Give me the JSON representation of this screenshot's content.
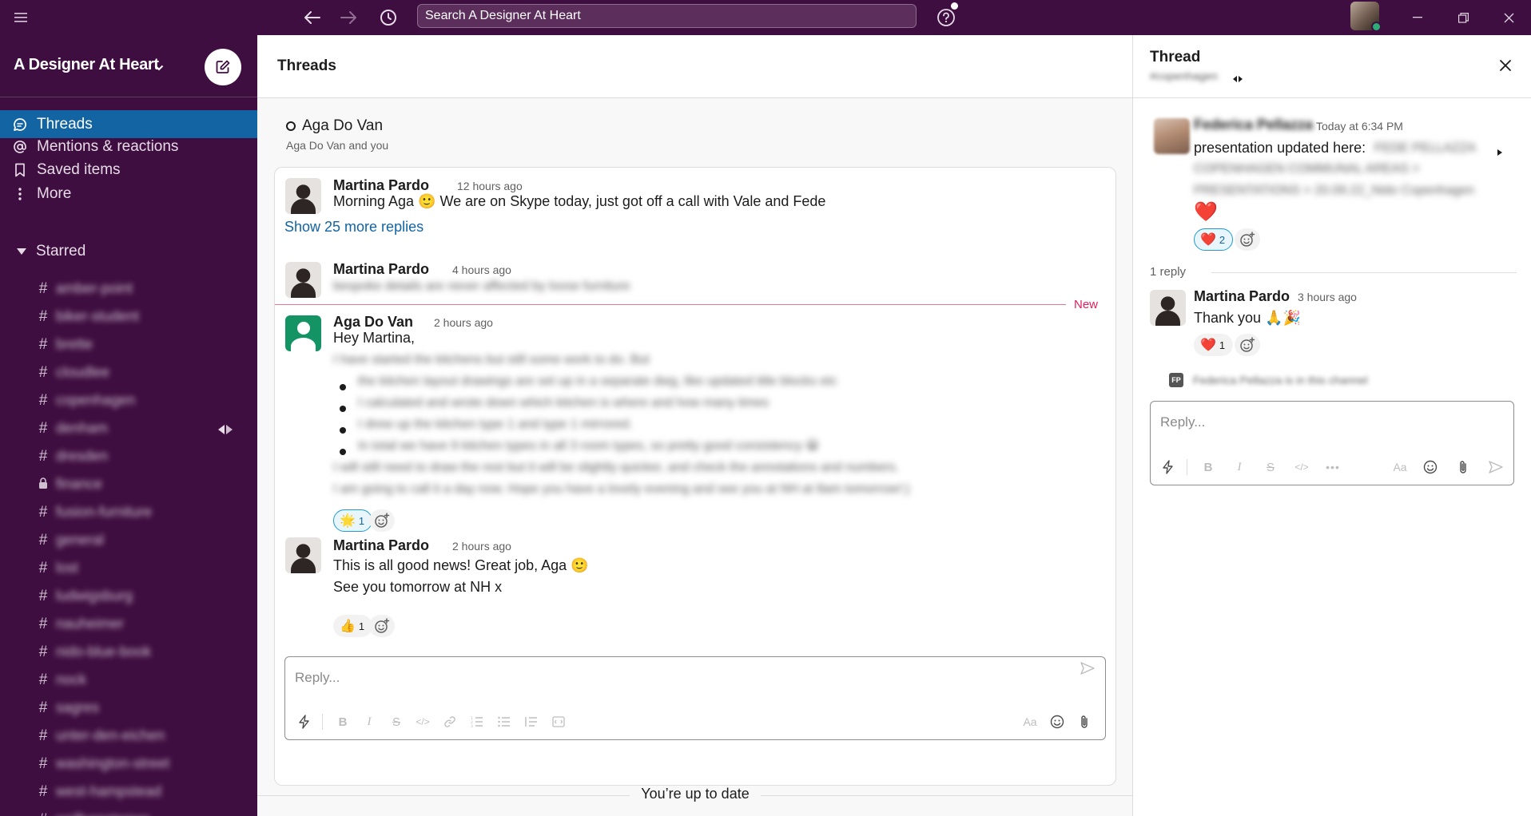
{
  "topbar": {
    "search_text": "Search A Designer At Heart"
  },
  "sidebar": {
    "workspace_name": "A Designer At Heart",
    "nav": [
      {
        "label": "Threads",
        "icon": "threads-icon",
        "active": true
      },
      {
        "label": "Mentions & reactions",
        "icon": "at-sign-icon",
        "active": false
      },
      {
        "label": "Saved items",
        "icon": "bookmark-icon",
        "active": false
      },
      {
        "label": "More",
        "icon": "more-vertical-icon",
        "active": false
      }
    ],
    "starred_label": "Starred",
    "channels": [
      {
        "name": "amber-point",
        "type": "public"
      },
      {
        "name": "biker-student",
        "type": "public"
      },
      {
        "name": "brette",
        "type": "public"
      },
      {
        "name": "cloudlee",
        "type": "public"
      },
      {
        "name": "copenhagen",
        "type": "shared"
      },
      {
        "name": "denham",
        "type": "public"
      },
      {
        "name": "dresden",
        "type": "public"
      },
      {
        "name": "finance",
        "type": "private"
      },
      {
        "name": "fusion-furniture",
        "type": "public"
      },
      {
        "name": "general",
        "type": "public"
      },
      {
        "name": "lost",
        "type": "public"
      },
      {
        "name": "ludwigsburg",
        "type": "public"
      },
      {
        "name": "nauheimer",
        "type": "public"
      },
      {
        "name": "nido-blue-book",
        "type": "public"
      },
      {
        "name": "nock",
        "type": "public"
      },
      {
        "name": "sagres",
        "type": "public"
      },
      {
        "name": "unter-den-eichen",
        "type": "public"
      },
      {
        "name": "washington-street",
        "type": "public"
      },
      {
        "name": "west-hampstead",
        "type": "public"
      },
      {
        "name": "wolfsensterner",
        "type": "public"
      }
    ]
  },
  "main": {
    "title": "Threads",
    "conversation": {
      "title": "Aga Do Van",
      "subtitle": "Aga Do Van and you"
    },
    "messages": [
      {
        "author": "Martina Pardo",
        "time": "12 hours ago",
        "text": "Morning Aga 🙂 We are on Skype today, just got off a call with Vale and Fede"
      },
      {
        "author": "Martina Pardo",
        "time": "4 hours ago",
        "text": "bespoke details are never affected by loose furniture"
      },
      {
        "author": "Aga Do Van",
        "time": "2 hours ago",
        "greeting": "Hey Martina,",
        "lines": [
          "I have started the kitchens but still some work to do. But",
          "I will still need to draw the rest but it will be slightly quicker, and check the annotations and numbers.",
          "I am going to call it a day now. Hope you have a lovely evening and see you at NH at 8am tomorrow!:)"
        ],
        "bullets": [
          "the kitchen layout drawings are set up in a separate dwg, like updated title blocks etc",
          "I calculated and wrote down which kitchen is where and how many times",
          "I drew up the kitchen type 1 and type 1 mirrored.",
          "In total we have 9 kitchen types in all 3 room types, so pretty good consistency 😀"
        ],
        "reaction": {
          "emoji": "🌟",
          "count": "1"
        }
      },
      {
        "author": "Martina Pardo",
        "time": "2 hours ago",
        "text": "This is all good news! Great job, Aga 🙂",
        "text2": "See you tomorrow at NH x",
        "reaction": {
          "emoji": "👍",
          "count": "1"
        }
      }
    ],
    "show_more": "Show 25 more replies",
    "new_label": "New",
    "reply_placeholder": "Reply...",
    "up_to_date": "You’re up to date"
  },
  "thread_pane": {
    "title": "Thread",
    "channel": "#copenhagen",
    "parent": {
      "author": "Federica Pellazza",
      "time": "Today at 6:34 PM",
      "text_prefix": "presentation updated here:",
      "path_line1": "FEDE PELLAZZA",
      "path_line2": "COPENHAGEN COMMUNAL AREAS >",
      "path_line3": "PRESENTATIONS > 20.09.22_Nido Copenhagen",
      "big_emoji": "❤️",
      "reaction": {
        "emoji": "❤️",
        "count": "2"
      }
    },
    "reply_count": "1 reply",
    "reply": {
      "author": "Martina Pardo",
      "time": "3 hours ago",
      "text": "Thank you 🙏🎉",
      "reaction": {
        "emoji": "❤️",
        "count": "1"
      }
    },
    "member_note": "Federica Pellazza is in this channel",
    "member_initials": "FP",
    "reply_placeholder": "Reply..."
  }
}
